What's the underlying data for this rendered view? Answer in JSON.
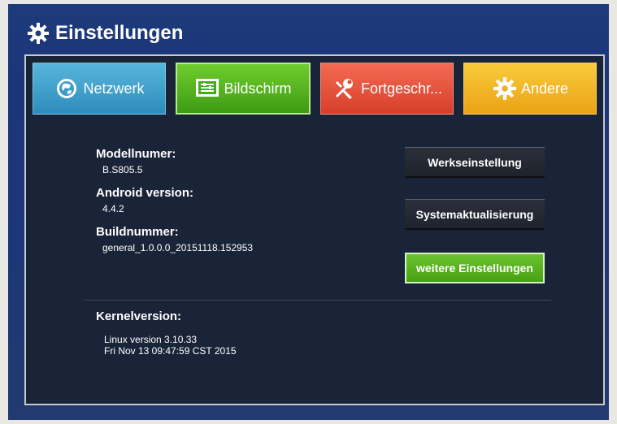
{
  "header": {
    "title": "Einstellungen",
    "icon": "gear-icon"
  },
  "tabs": [
    {
      "label": "Netzwerk",
      "icon": "globe-icon",
      "color": "#3ea0cd"
    },
    {
      "label": "Bildschirm",
      "icon": "display-settings-icon",
      "color": "#53b31e"
    },
    {
      "label": "Fortgeschr...",
      "icon": "tools-icon",
      "color": "#e5533d"
    },
    {
      "label": "Andere",
      "icon": "gear-icon",
      "color": "#f1b726"
    }
  ],
  "info": {
    "model_label": "Modellnumer:",
    "model_value": "B.S805.5",
    "android_label": "Android version:",
    "android_value": "4.4.2",
    "build_label": "Buildnummer:",
    "build_value": "general_1.0.0.0_20151118.152953"
  },
  "buttons": {
    "factory_reset": "Werkseinstellung",
    "system_update": "Systemaktualisierung",
    "more_settings": "weitere Einstellungen"
  },
  "kernel": {
    "label": "Kernelversion:",
    "line1": "Linux version 3.10.33",
    "line2": "Fri Nov 13 09:47:59 CST 2015"
  }
}
